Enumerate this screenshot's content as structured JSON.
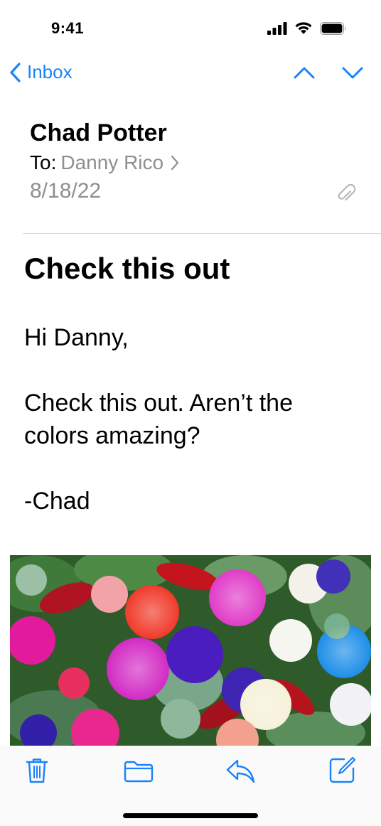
{
  "status_bar": {
    "time": "9:41",
    "icons": [
      "signal-icon",
      "wifi-icon",
      "battery-icon"
    ]
  },
  "nav": {
    "back_label": "Inbox",
    "icons": [
      "chevron-left-icon",
      "chevron-up-icon",
      "chevron-down-icon"
    ]
  },
  "email": {
    "sender": "Chad Potter",
    "to_label": "To:",
    "recipient": "Danny Rico",
    "date": "8/18/22",
    "subject": "Check this out",
    "body": [
      "Hi Danny,",
      "Check this out. Aren’t the colors amazing?",
      "-Chad"
    ],
    "attachment_icon": "paperclip-icon"
  },
  "toolbar": {
    "icons": [
      "trash-icon",
      "folder-icon",
      "reply-icon",
      "compose-icon"
    ]
  },
  "colors": {
    "accent": "#1a82fb",
    "secondary_text": "#8e8e93"
  }
}
